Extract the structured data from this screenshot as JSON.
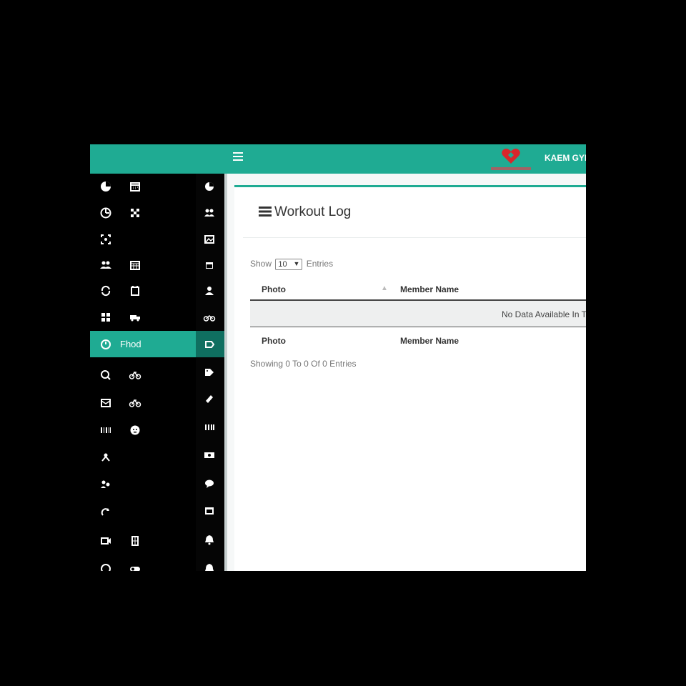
{
  "topbar": {
    "menu_icon": "hamburger-icon",
    "brand_name": "KAEM GYM",
    "logo_icon": "heart-logo",
    "colors": {
      "accent": "#1fab93",
      "logo": "#d9262b"
    }
  },
  "sidebar": {
    "active_item_label": "Fhod",
    "icons": [
      "pie-chart-icon",
      "calendar-icon",
      "pie-chart-icon",
      "clock-chart-icon",
      "grid-icon",
      "users-icon",
      "scan-icon",
      "image-icon",
      "users-icon",
      "calendar-icon",
      "calendar-icon",
      "cycle-icon",
      "calendar-check-icon",
      "user-icon",
      "apps-icon",
      "truck-icon",
      "bike-icon",
      "dashboard-icon",
      "tag-icon",
      "search-icon",
      "bike-icon",
      "tag-icon",
      "mail-icon",
      "bike-icon",
      "timeline-icon",
      "barcode-icon",
      "face-icon",
      "money-icon",
      "network-icon",
      "chat-icon",
      "users-icon",
      "window-icon",
      "refresh-icon",
      "bell-icon",
      "video-icon",
      "building-icon",
      "bell-icon",
      "gauge-icon",
      "toggle-icon",
      "bell-icon"
    ]
  },
  "main": {
    "title": "Workout Log",
    "show_label": "Show",
    "entries_select_value": "10",
    "entries_label": "Entries",
    "table": {
      "columns": [
        "Photo",
        "Member Name"
      ],
      "empty_text": "No Data Available In Ta"
    },
    "footer_info": "Showing 0 To 0 Of 0 Entries"
  }
}
